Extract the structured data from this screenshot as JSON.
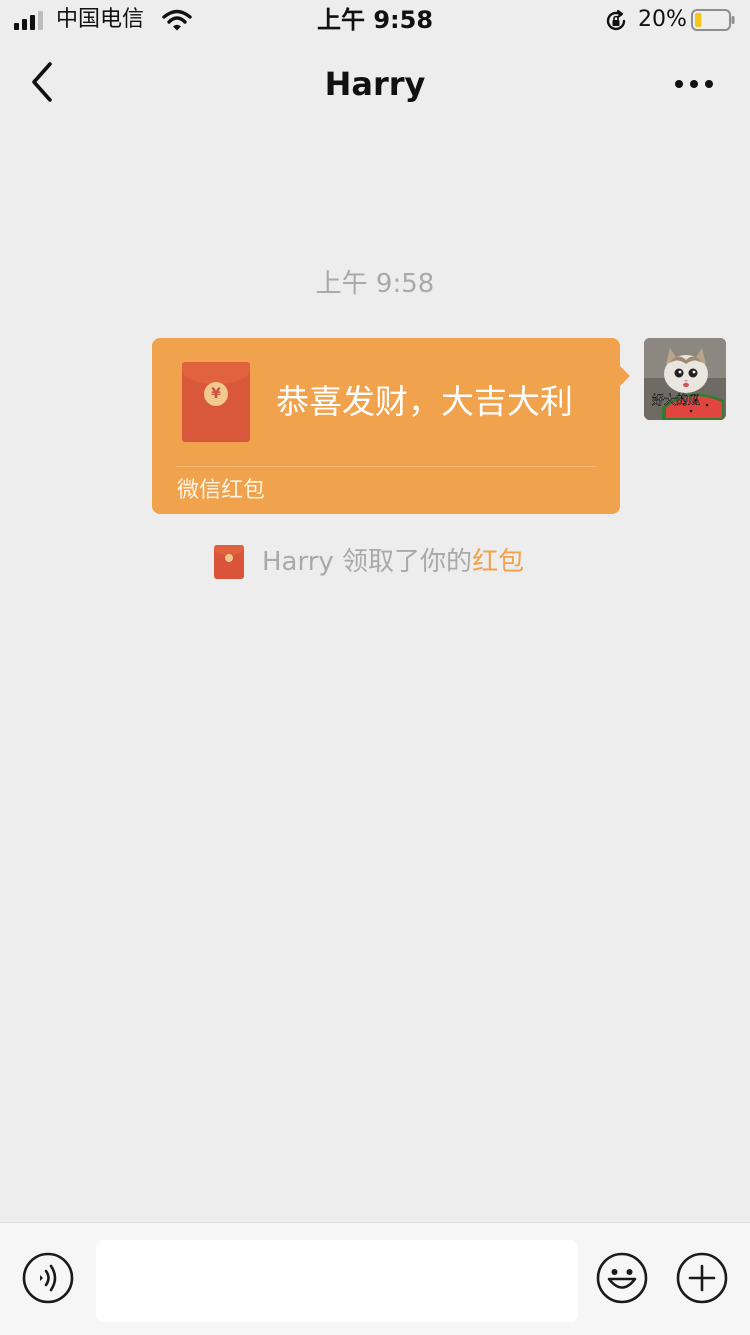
{
  "status_bar": {
    "carrier": "中国电信",
    "time": "上午 9:58",
    "battery_percent": "20%",
    "battery_level": 0.2
  },
  "nav": {
    "title": "Harry",
    "back_icon": "chevron-left-icon",
    "more_icon": "more-dots-icon"
  },
  "chat": {
    "timestamp": "上午 9:58",
    "red_packet": {
      "message": "恭喜发财，大吉大利",
      "footer": "微信红包",
      "coin_symbol": "¥",
      "bubble_color": "#f0a24d",
      "envelope_color": "#d9583b"
    },
    "avatar_caption": "好大的瓜",
    "notice": {
      "prefix": "Harry 领取了你的",
      "link": "红包"
    }
  },
  "input_bar": {
    "voice_icon": "voice-icon",
    "emoji_icon": "emoji-icon",
    "plus_icon": "plus-icon",
    "input_value": ""
  }
}
